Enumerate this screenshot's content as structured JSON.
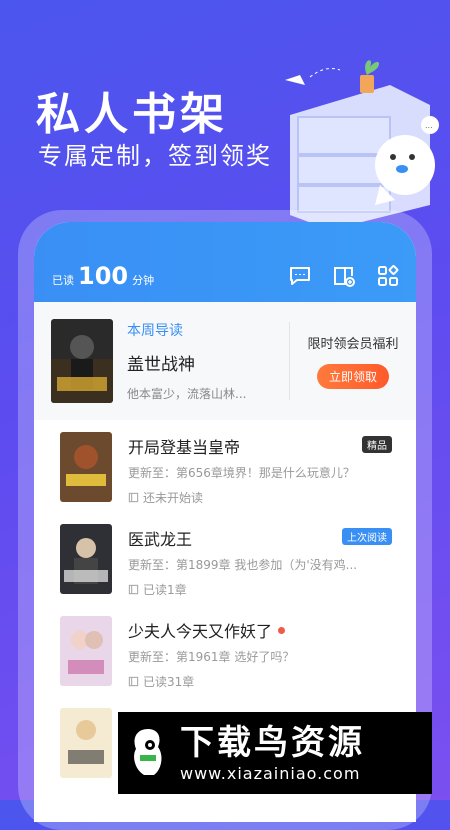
{
  "promo": {
    "title": "私人书架",
    "subtitle": "专属定制，签到领奖"
  },
  "header": {
    "read_label_prefix": "已读",
    "read_minutes": "100",
    "read_label_suffix": "分钟"
  },
  "weekly_pick": {
    "tag": "本周导读",
    "title": "盖世战神",
    "description": "他本富少，流落山林...",
    "vip_text": "限时领会员福利",
    "vip_button": "立即领取"
  },
  "books": [
    {
      "title": "开局登基当皇帝",
      "update": "更新至：第656章境界！那是什么玩意儿？",
      "progress": "还未开始读",
      "badge": "精品",
      "badge_style": "dark",
      "unread_dot": false
    },
    {
      "title": "医武龙王",
      "update": "更新至：第1899章 我也参加（为'没有鸡...",
      "progress": "已读1章",
      "badge": "上次阅读",
      "badge_style": "blue",
      "unread_dot": false
    },
    {
      "title": "少夫人今天又作妖了",
      "update": "更新至：第1961章 选好了吗？",
      "progress": "已读31章",
      "badge": "",
      "badge_style": "",
      "unread_dot": true
    }
  ],
  "watermark": {
    "title": "下载鸟资源",
    "url": "www.xiazainiao.com"
  },
  "colors": {
    "accent": "#3a8ff5",
    "cta": "#ff6a33",
    "background": "#5a4ff0"
  }
}
